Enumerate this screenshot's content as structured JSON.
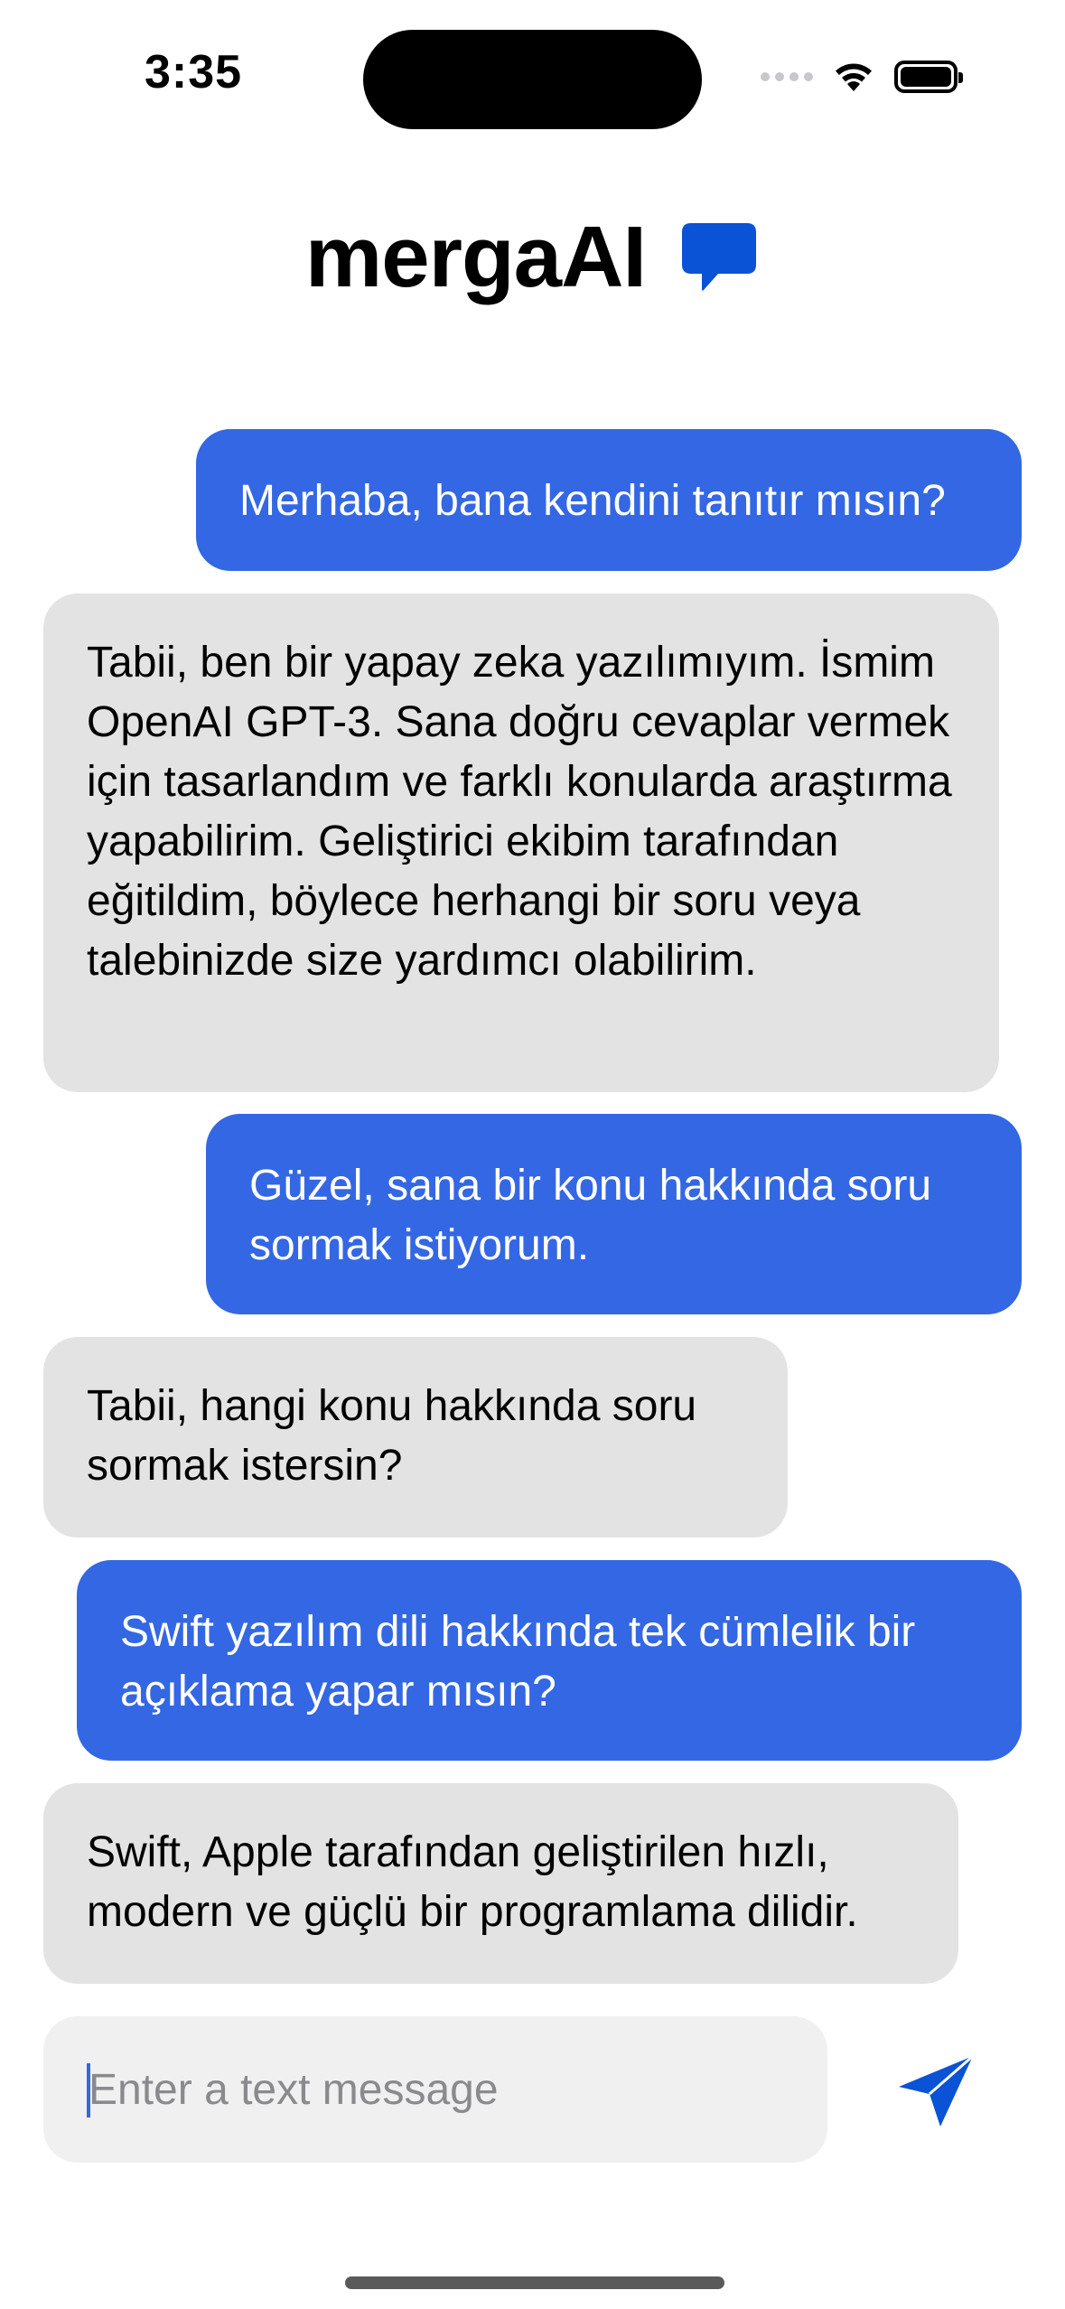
{
  "status_bar": {
    "time": "3:35"
  },
  "header": {
    "title": "mergaAI",
    "icon": "chat-bubble-icon",
    "accent_color": "#0a52d6"
  },
  "messages": [
    {
      "role": "user",
      "text": "Merhaba, bana kendini tanıtır mısın?"
    },
    {
      "role": "assistant",
      "text": "Tabii, ben bir yapay zeka yazılımıyım. İsmim OpenAI GPT-3. Sana doğru cevaplar vermek için tasarlandım ve farklı konularda araştırma yapabilirim. Geliştirici ekibim tarafından eğitildim, böylece herhangi bir soru veya talebinizde size yardımcı olabilirim."
    },
    {
      "role": "user",
      "text": "Güzel, sana bir konu hakkında soru sormak istiyorum."
    },
    {
      "role": "assistant",
      "text": "Tabii, hangi konu hakkında soru sormak istersin?"
    },
    {
      "role": "user",
      "text": "Swift yazılım dili hakkında tek cümlelik bir açıklama yapar mısın?"
    },
    {
      "role": "assistant",
      "text": "Swift, Apple tarafından geliştirilen hızlı, modern ve güçlü bir programlama dilidir."
    }
  ],
  "colors": {
    "user_bubble": "#3467e3",
    "assistant_bubble": "#e3e3e3",
    "input_background": "#f0f0f0"
  },
  "composer": {
    "placeholder": "Enter a text message",
    "value": "",
    "send_icon": "paper-plane-icon"
  }
}
